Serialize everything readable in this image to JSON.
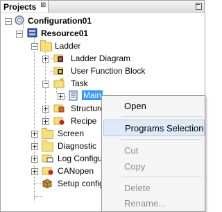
{
  "panel": {
    "title": "Projects",
    "close_glyph": "⊠"
  },
  "tree": {
    "configuration": "Configuration01",
    "resource": "Resource01",
    "ladder": "Ladder",
    "ladder_diagram": "Ladder Diagram",
    "user_function_block": "User Function Block",
    "task": "Task",
    "main": "Main",
    "structure": "Structure",
    "recipe": "Recipe",
    "screen": "Screen",
    "diagnostic": "Diagnostic",
    "log_configuration": "Log Configur",
    "canopen": "CANopen",
    "setup_configuration": "Setup configu"
  },
  "context_menu": {
    "open": "Open",
    "programs_selection": "Programs Selection",
    "cut": "Cut",
    "copy": "Copy",
    "delete": "Delete",
    "rename": "Rename..."
  },
  "colors": {
    "selection": "#3399ff",
    "menu_hover": "#dfeaf7",
    "folder": "#f7e07a",
    "disabled_text": "#8d8d8d"
  }
}
